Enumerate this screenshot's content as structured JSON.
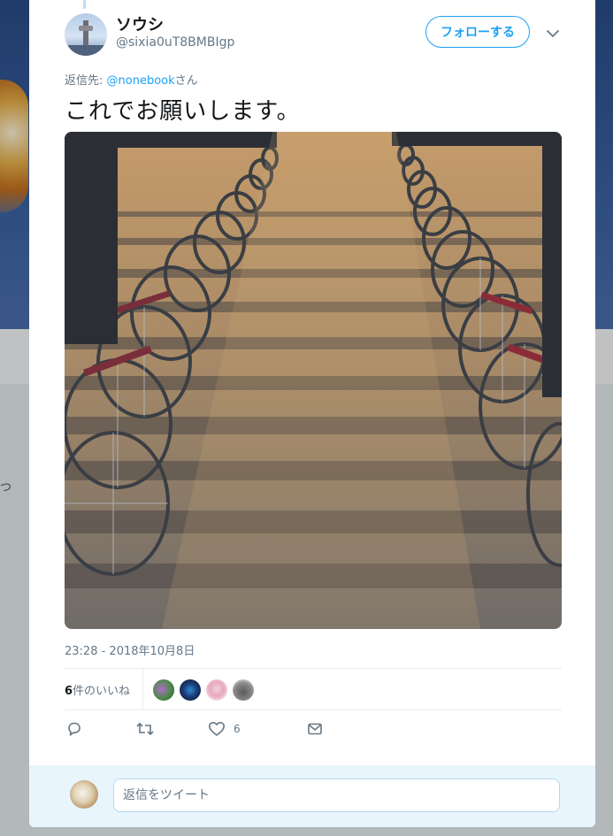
{
  "tweet": {
    "display_name": "ソウシ",
    "screen_name": "@sixia0uT8BMBIgp",
    "follow_label": "フォローする",
    "reply_to_prefix": "返信先: ",
    "reply_to_user": "@nonebook",
    "reply_to_suffix": "さん",
    "text": "これでお願いします。",
    "timestamp": "23:28 - 2018年10月8日",
    "likes_count": "6",
    "likes_label": "件のいいね",
    "like_action_count": "6"
  },
  "reply_box": {
    "placeholder": "返信をツイート"
  },
  "background": {
    "partial_text": "つ"
  },
  "colors": {
    "accent": "#1da1f2",
    "secondary_text": "#657786",
    "reply_area_bg": "#e8f5fd"
  },
  "icons": {
    "caret": "chevron-down-icon",
    "reply": "reply-icon",
    "retweet": "retweet-icon",
    "like": "heart-icon",
    "dm": "envelope-icon"
  }
}
